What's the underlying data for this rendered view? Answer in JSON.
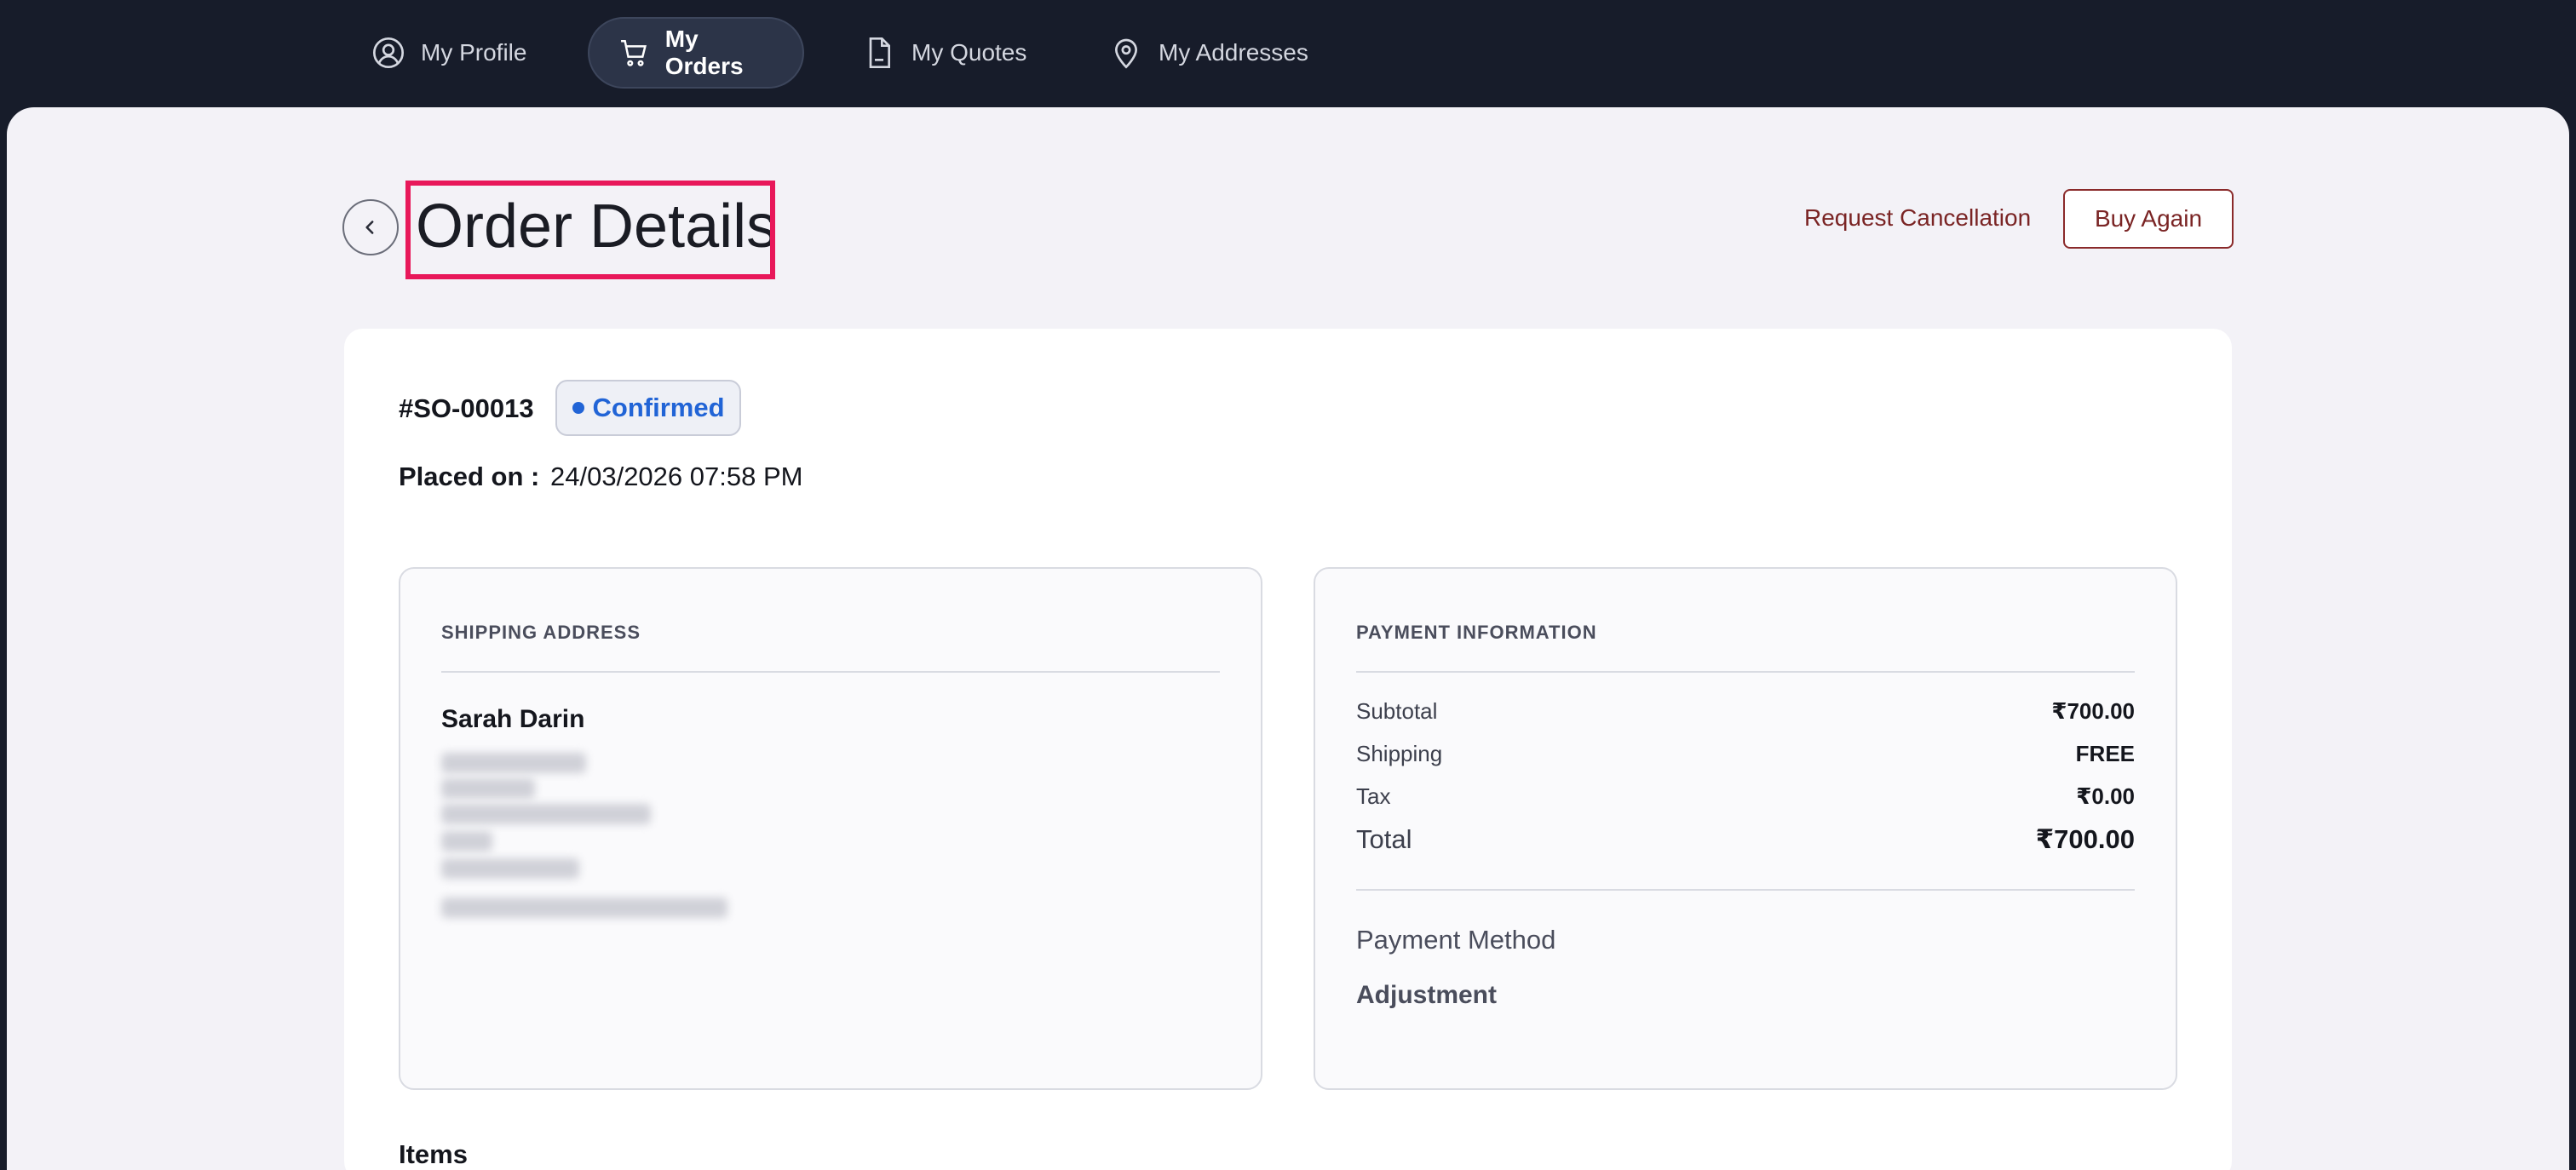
{
  "nav": {
    "items": [
      {
        "label": "My Profile",
        "icon": "user-circle-icon"
      },
      {
        "label": "My Orders",
        "icon": "cart-icon",
        "active": true
      },
      {
        "label": "My Quotes",
        "icon": "document-icon"
      },
      {
        "label": "My Addresses",
        "icon": "map-pin-icon"
      }
    ]
  },
  "page": {
    "title": "Order Details",
    "request_cancellation": "Request Cancellation",
    "buy_again": "Buy Again"
  },
  "order": {
    "id": "#SO-00013",
    "status": "Confirmed",
    "placed_label": "Placed on :",
    "placed_value": "24/03/2026 07:58 PM"
  },
  "shipping": {
    "heading": "SHIPPING ADDRESS",
    "name": "Sarah Darin"
  },
  "payment": {
    "heading": "PAYMENT INFORMATION",
    "subtotal_label": "Subtotal",
    "subtotal_value": "₹700.00",
    "shipping_label": "Shipping",
    "shipping_value": "FREE",
    "tax_label": "Tax",
    "tax_value": "₹0.00",
    "total_label": "Total",
    "total_value": "₹700.00",
    "method_label": "Payment Method",
    "method_value": "Adjustment"
  },
  "items": {
    "heading": "Items"
  },
  "colors": {
    "nav_bg": "#171c2a",
    "accent_status": "#2164d6",
    "highlight": "#e8185a",
    "action_text": "#7a2424"
  }
}
